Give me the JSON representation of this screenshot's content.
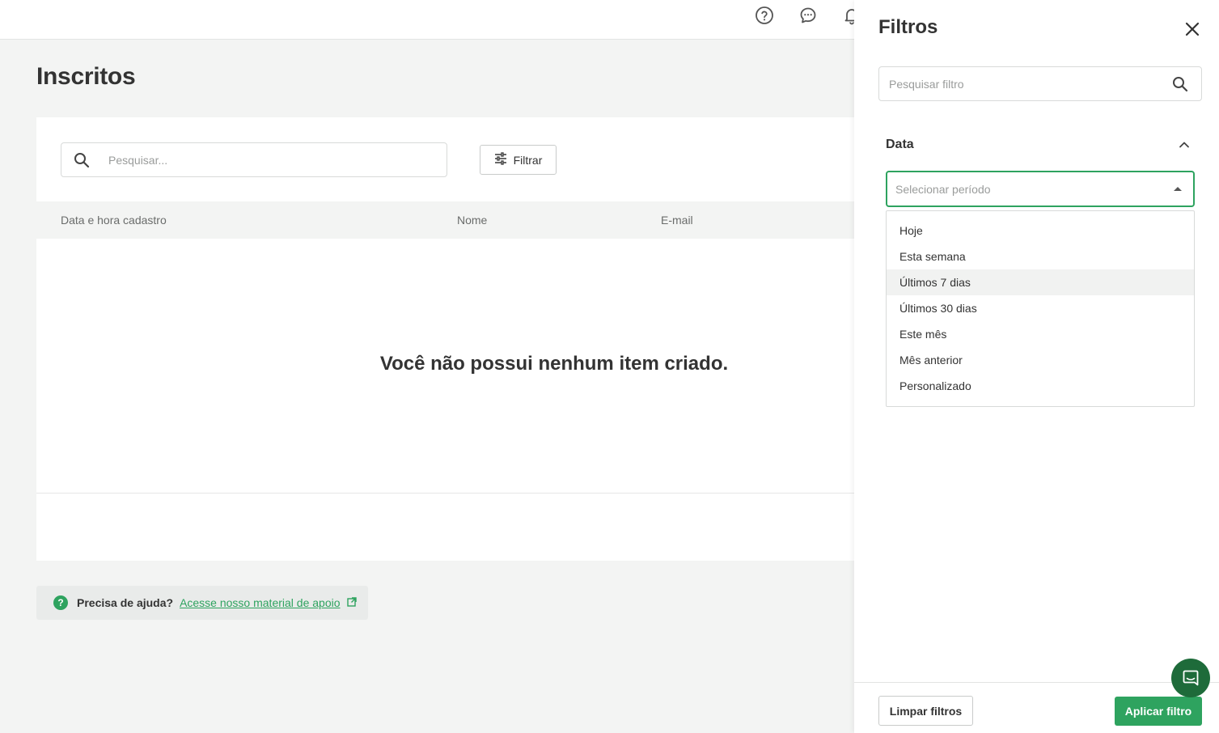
{
  "header": {
    "icons": [
      "help-icon",
      "chat-icon",
      "bell-icon"
    ]
  },
  "page": {
    "title": "Inscritos",
    "search": {
      "placeholder": "Pesquisar..."
    },
    "filter_button": "Filtrar",
    "table": {
      "columns": [
        "Data e hora cadastro",
        "Nome",
        "E-mail"
      ]
    },
    "empty_message": "Você não possui nenhum item criado.",
    "help": {
      "title": "Precisa de ajuda?",
      "link": "Acesse nosso material de apoio"
    }
  },
  "drawer": {
    "title": "Filtros",
    "search": {
      "placeholder": "Pesquisar filtro"
    },
    "section": {
      "label": "Data",
      "select": {
        "placeholder": "Selecionar período"
      },
      "options": [
        "Hoje",
        "Esta semana",
        "Últimos 7 dias",
        "Últimos 30 dias",
        "Este mês",
        "Mês anterior",
        "Personalizado"
      ],
      "highlighted_option": "Últimos 7 dias"
    },
    "footer": {
      "clear_label": "Limpar filtros",
      "apply_label": "Aplicar filtro"
    }
  },
  "colors": {
    "accent": "#2ea35f",
    "chat_bubble": "#1e6b3a",
    "notification": "#e0304a"
  }
}
